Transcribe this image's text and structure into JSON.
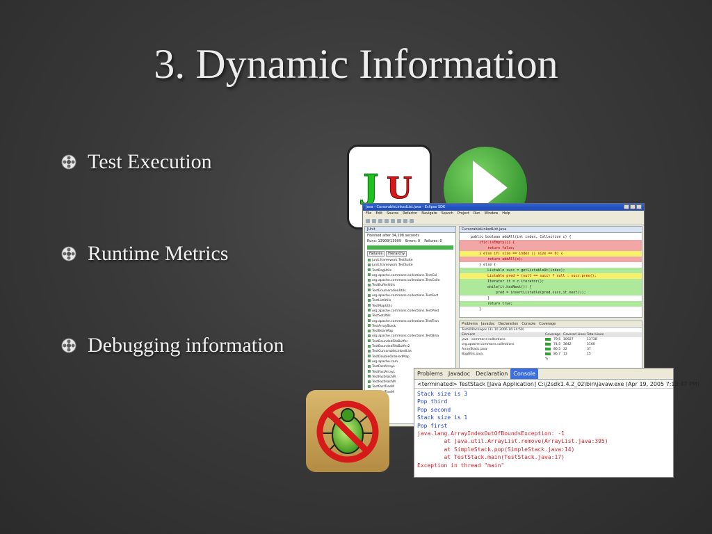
{
  "title": "3. Dynamic Information",
  "bullets": [
    {
      "text": "Test Execution"
    },
    {
      "text": "Runtime Metrics"
    },
    {
      "text": "Debugging information"
    }
  ],
  "junit_logo": {
    "text": "JU",
    "colors": {
      "j": "#1fc21f",
      "u": "#d61a1a"
    }
  },
  "colors": {
    "background": "#3a3a3a",
    "play_green": "#4aa84a",
    "bug_tan": "#c9a65e",
    "junit_bar": "#45b64b",
    "console_blue": "#1b3fc9",
    "console_red": "#d2222a"
  },
  "icons": [
    "bullet-icon",
    "junit-logo-icon",
    "play-icon",
    "bug-forbidden-icon"
  ],
  "eclipse": {
    "window_title": "Java - CursorableLinkedList.java - Eclipse SDK",
    "menu": [
      "File",
      "Edit",
      "Source",
      "Refactor",
      "Navigate",
      "Search",
      "Project",
      "Run",
      "Window",
      "Help"
    ],
    "junit": {
      "tab": "JUnit",
      "finished": "Finished after 34,298 seconds",
      "runs": "Runs: 13909/13909",
      "errors": "Errors: 0",
      "failures": "Failures: 0",
      "subtabs": [
        "Failures",
        "Hierarchy"
      ],
      "tree": [
        "junit.framework.TestSuite",
        "junit.framework.TestSuite",
        "TestBagUtils",
        "org.apache.commons.collections.TestCol",
        "org.apache.commons.collections.TestColle",
        "TestBufferUtils",
        "TestEnumerationUtils",
        "org.apache.commons.collections.TestFact",
        "TestListUtils",
        "TestMapUtils",
        "org.apache.commons.collections.TestPred",
        "TestSetUtils",
        "org.apache.commons.collections.TestTran",
        "TestArrayStack",
        "TestBeanMap",
        "org.apache.commons.collections.TestBina",
        "TestBoundedFifoBuffer",
        "TestBoundedFifoBuffer2",
        "TestCursorableLinkedList",
        "TestDoubleOrderedMap",
        "org.apache.com",
        "TestFastArrayL",
        "TestFastArrayL",
        "TestFastHashM",
        "TestFastHashM",
        "TestFastTreeM",
        "TestFastTreeM"
      ]
    },
    "editor": {
      "tab": "CursorableLinkedList.java",
      "code": [
        {
          "text": "    public boolean addAll(int index, Collection c) {",
          "hl": ""
        },
        {
          "text": "        if(c.isEmpty()) {",
          "hl": "red"
        },
        {
          "text": "            return false;",
          "hl": "red"
        },
        {
          "text": "        } else if( size == index || size == 0) {",
          "hl": "yel"
        },
        {
          "text": "            return addAll(c);",
          "hl": "red"
        },
        {
          "text": "        } else {",
          "hl": ""
        },
        {
          "text": "            Listable succ = getListableAt(index);",
          "hl": "grn"
        },
        {
          "text": "            Listable pred = (null == succ) ? null : succ.prev();",
          "hl": "yel"
        },
        {
          "text": "            Iterator it = c.iterator();",
          "hl": "grn"
        },
        {
          "text": "            while(it.hasNext()) {",
          "hl": "grn"
        },
        {
          "text": "                pred = insertListable(pred,succ,it.next());",
          "hl": "grn"
        },
        {
          "text": "            }",
          "hl": ""
        },
        {
          "text": "            return true;",
          "hl": "grn"
        },
        {
          "text": "        }",
          "hl": ""
        }
      ]
    },
    "coverage": {
      "tabs": [
        "Problems",
        "Javadoc",
        "Declaration",
        "Console",
        "Coverage"
      ],
      "session": "TestAllPackages (31.10.2006 16:34:59)",
      "columns": [
        "Element",
        "Coverage",
        "Covered Lines",
        "Total Lines"
      ],
      "rows": [
        {
          "element": "java - commons-collections",
          "coverage": "79,5 %",
          "covered": "10927",
          "total": "13738"
        },
        {
          "element": "org.apache.commons.collections",
          "coverage": "74,5 %",
          "covered": "3842",
          "total": "5160"
        },
        {
          "element": "ArrayStack.java",
          "coverage": "86,5 %",
          "covered": "32",
          "total": "37"
        },
        {
          "element": "BagUtils.java",
          "coverage": "86,7 %",
          "covered": "13",
          "total": "15"
        }
      ]
    }
  },
  "console": {
    "tabs": [
      "Problems",
      "Javadoc",
      "Declaration",
      "Console"
    ],
    "status": "<terminated> TestStack [Java Application] C:\\j2sdk1.4.2_02\\bin\\javaw.exe (Apr 19, 2005 7:13:47 PM)",
    "lines": [
      {
        "text": "Stack size is 3",
        "kind": "out"
      },
      {
        "text": "Pop third",
        "kind": "out"
      },
      {
        "text": "Pop second",
        "kind": "out"
      },
      {
        "text": "Stack size is 1",
        "kind": "out"
      },
      {
        "text": "Pop first",
        "kind": "out"
      },
      {
        "text": "java.lang.ArrayIndexOutOfBoundsException: -1",
        "kind": "err"
      },
      {
        "text": "        at java.util.ArrayList.remove(ArrayList.java:395)",
        "kind": "err"
      },
      {
        "text": "        at SimpleStack.pop(SimpleStack.java:14)",
        "kind": "err"
      },
      {
        "text": "        at TestStack.main(TestStack.java:17)",
        "kind": "err"
      },
      {
        "text": "Exception in thread \"main\"",
        "kind": "err"
      }
    ]
  }
}
